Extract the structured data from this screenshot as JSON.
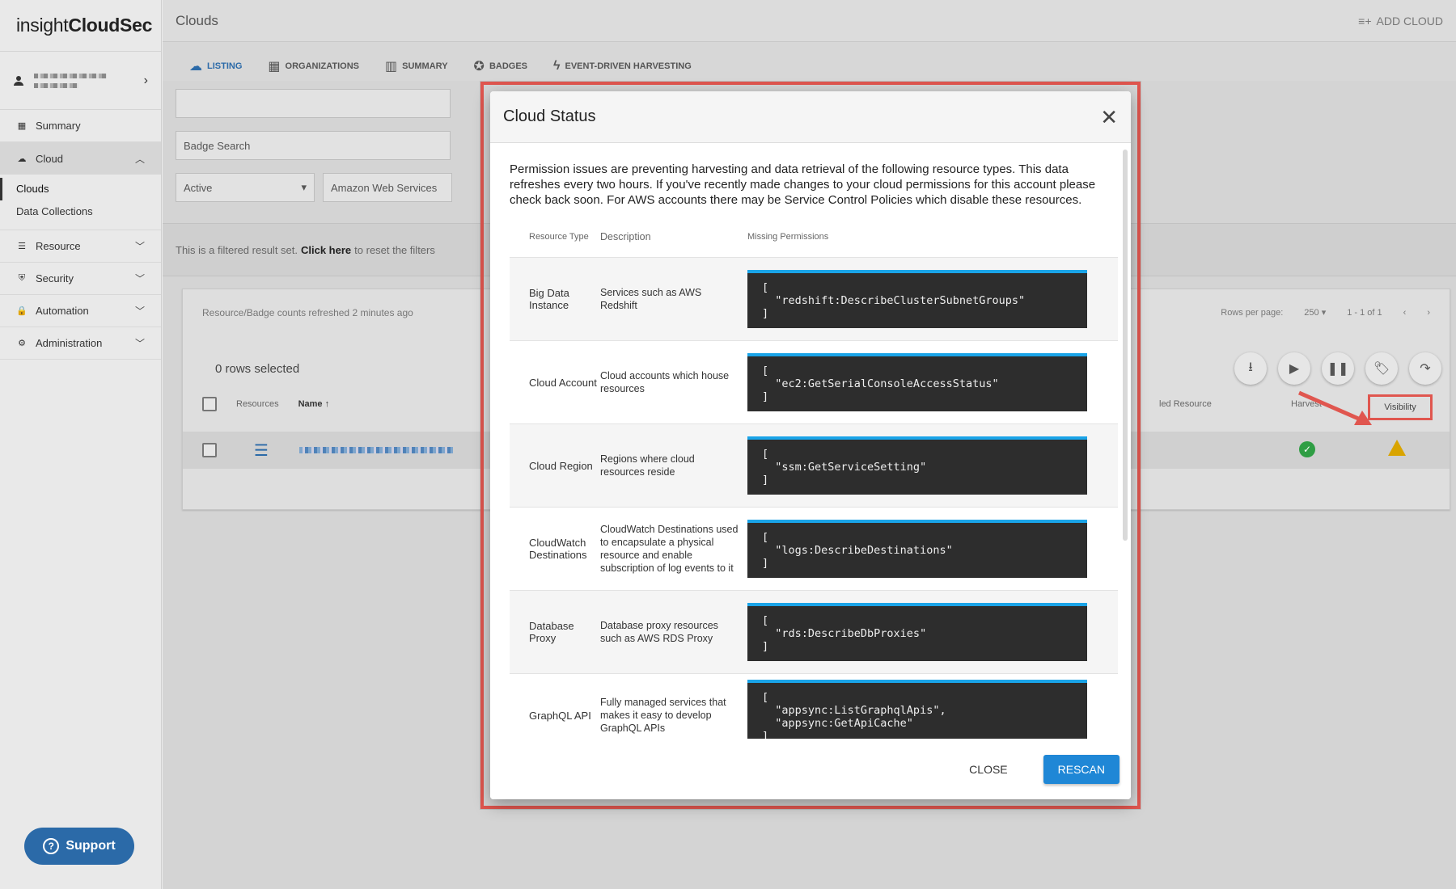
{
  "app": {
    "logo_prefix": "insight",
    "logo_suffix": "CloudSec"
  },
  "sidebar": {
    "items": [
      {
        "label": "Summary",
        "icon": "grid-icon"
      },
      {
        "label": "Cloud",
        "icon": "cloud-icon",
        "expanded": true
      },
      {
        "label": "Resource",
        "icon": "list-icon"
      },
      {
        "label": "Security",
        "icon": "shield-icon"
      },
      {
        "label": "Automation",
        "icon": "lock-icon"
      },
      {
        "label": "Administration",
        "icon": "gear-icon"
      }
    ],
    "cloud_sub": [
      "Clouds",
      "Data Collections"
    ],
    "support": "Support"
  },
  "header": {
    "title": "Clouds",
    "add_cloud": "ADD CLOUD"
  },
  "tabs": [
    "LISTING",
    "ORGANIZATIONS",
    "SUMMARY",
    "BADGES",
    "EVENT-DRIVEN HARVESTING"
  ],
  "filters": {
    "search_value": "",
    "badge_placeholder": "Badge Search",
    "status": "Active",
    "provider": "Amazon Web Services",
    "notice_pre": "This is a filtered result set.",
    "notice_link": "Click here",
    "notice_post": "to reset the filters"
  },
  "listing": {
    "refreshed": "Resource/Badge counts refreshed 2 minutes ago",
    "rows_per_page_label": "Rows per page:",
    "rows_per_page": "250",
    "range": "1 - 1 of 1",
    "rows_selected": "0 rows selected",
    "columns": {
      "resources": "Resources",
      "name": "Name",
      "failed": "led Resource",
      "harvest": "Harvest",
      "visibility": "Visibility"
    }
  },
  "modal": {
    "title": "Cloud Status",
    "intro": "Permission issues are preventing harvesting and data retrieval of the following resource types. This data refreshes every two hours. If you've recently made changes to your cloud permissions for this account please check back soon. For AWS accounts there may be Service Control Policies which disable these resources.",
    "columns": [
      "Resource Type",
      "Description",
      "Missing Permissions"
    ],
    "rows": [
      {
        "type": "Big Data Instance",
        "desc": "Services such as AWS Redshift",
        "perms": "[\n  \"redshift:DescribeClusterSubnetGroups\"\n]"
      },
      {
        "type": "Cloud Account",
        "desc": "Cloud accounts which house resources",
        "perms": "[\n  \"ec2:GetSerialConsoleAccessStatus\"\n]"
      },
      {
        "type": "Cloud Region",
        "desc": "Regions where cloud resources reside",
        "perms": "[\n  \"ssm:GetServiceSetting\"\n]"
      },
      {
        "type": "CloudWatch Destinations",
        "desc": "CloudWatch Destinations used to encapsulate a physical resource and enable subscription of log events to it",
        "perms": "[\n  \"logs:DescribeDestinations\"\n]"
      },
      {
        "type": "Database Proxy",
        "desc": "Database proxy resources such as AWS RDS Proxy",
        "perms": "[\n  \"rds:DescribeDbProxies\"\n]"
      },
      {
        "type": "GraphQL API",
        "desc": "Fully managed services that makes it easy to develop GraphQL APIs",
        "perms": "[\n  \"appsync:ListGraphqlApis\",\n  \"appsync:GetApiCache\"\n]"
      }
    ],
    "close": "CLOSE",
    "rescan": "RESCAN"
  },
  "colors": {
    "accent": "#1f87d6",
    "highlight": "#e0564f",
    "code_bg": "#2d2d2d",
    "code_bar": "#1aa4e8"
  }
}
